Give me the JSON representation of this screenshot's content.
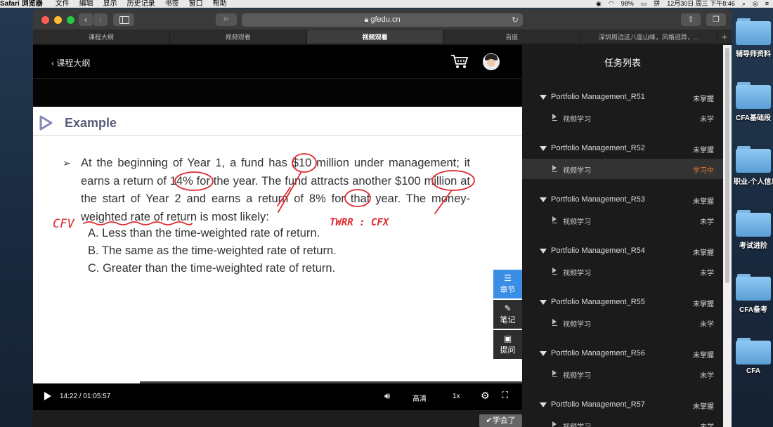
{
  "menubar": {
    "app_name": "Safari 浏览器",
    "items": [
      "文件",
      "编辑",
      "显示",
      "历史记录",
      "书签",
      "窗口",
      "帮助"
    ],
    "battery": "98%",
    "input_method": "拼",
    "datetime": "12月30日 周三 下午8:46"
  },
  "desktop": {
    "folders": [
      "辅导师资料",
      "CFA基础段",
      "职业-个人信息",
      "考试进阶",
      "CFA备考",
      "CFA"
    ]
  },
  "browser": {
    "url": "gfedu.cn",
    "tabs": [
      {
        "label": "课程大纲",
        "active": false
      },
      {
        "label": "视频观看",
        "active": false
      },
      {
        "label": "视频观看",
        "active": true
      },
      {
        "label": "百度",
        "active": false
      },
      {
        "label": "深圳周边这八座山峰，风格迥异，...",
        "active": false
      }
    ]
  },
  "player": {
    "back_label": "课程大纲",
    "slide": {
      "title": "Example",
      "question": "At the beginning of Year 1, a fund has $10 million under management; it earns a return of 14% for the year. The fund attracts another $100 million at the start of Year 2 and earns a return of 8% for that year. The money-weighted rate of return is most likely:",
      "options": [
        "A.  Less than the time-weighted rate of return.",
        "B.  The same as the time-weighted rate of return.",
        "C.  Greater than the time-weighted rate of return."
      ],
      "handwriting": [
        "CFV",
        "TWRR : CFX"
      ]
    },
    "side_tools": [
      "章节",
      "笔记",
      "提问"
    ],
    "time": "14:22 / 01:05:57",
    "progress": 0.218,
    "quality": "高清",
    "speed": "1x",
    "learned_label": "学会了"
  },
  "task_panel": {
    "title": "任务列表",
    "chapters": [
      {
        "name": "Portfolio Management_R51",
        "status": "未掌握",
        "lesson": "视频学习",
        "lesson_status": "未学",
        "active": false
      },
      {
        "name": "Portfolio Management_R52",
        "status": "未掌握",
        "lesson": "视频学习",
        "lesson_status": "学习中",
        "active": true
      },
      {
        "name": "Portfolio Management_R53",
        "status": "未掌握",
        "lesson": "视频学习",
        "lesson_status": "未学",
        "active": false
      },
      {
        "name": "Portfolio Management_R54",
        "status": "未掌握",
        "lesson": "视频学习",
        "lesson_status": "未学",
        "active": false
      },
      {
        "name": "Portfolio Management_R55",
        "status": "未掌握",
        "lesson": "视频学习",
        "lesson_status": "未学",
        "active": false
      },
      {
        "name": "Portfolio Management_R56",
        "status": "未掌握",
        "lesson": "视频学习",
        "lesson_status": "未学",
        "active": false
      },
      {
        "name": "Portfolio Management_R57",
        "status": "未掌握",
        "lesson": "视频学习",
        "lesson_status": "未学",
        "active": false
      }
    ]
  },
  "colors": {
    "accent_blue": "#3a8ee6",
    "active_status": "#f07a2c",
    "annotation_red": "#e0282d"
  }
}
